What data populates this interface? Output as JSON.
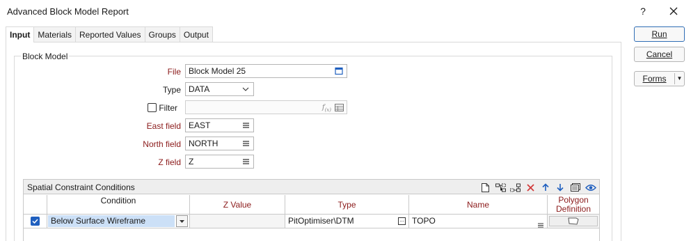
{
  "window": {
    "title": "Advanced Block Model Report",
    "help_label": "?"
  },
  "tabs": [
    {
      "label": "Input",
      "active": true
    },
    {
      "label": "Materials",
      "active": false
    },
    {
      "label": "Reported Values",
      "active": false
    },
    {
      "label": "Groups",
      "active": false
    },
    {
      "label": "Output",
      "active": false
    }
  ],
  "buttons": {
    "run_label": "Run",
    "cancel_label": "Cancel",
    "forms_label": "Forms",
    "forms_arrow": "▼"
  },
  "block_model": {
    "legend": "Block Model",
    "file_label": "File",
    "file_value": "Block Model 25",
    "type_label": "Type",
    "type_value": "DATA",
    "filter_label": "Filter",
    "filter_checked": false,
    "filter_value": "",
    "east_label": "East field",
    "east_value": "EAST",
    "north_label": "North field",
    "north_value": "NORTH",
    "z_label": "Z field",
    "z_value": "Z"
  },
  "spatial": {
    "title": "Spatial Constraint Conditions",
    "columns": {
      "condition": "Condition",
      "zvalue": "Z Value",
      "type": "Type",
      "name": "Name",
      "polygon_line1": "Polygon",
      "polygon_line2": "Definition"
    },
    "rows": [
      {
        "checked": true,
        "condition": "Below Surface Wireframe",
        "zvalue": "",
        "type": "PitOptimiser\\DTM",
        "name": "TOPO"
      }
    ],
    "toolbar_icons": [
      "new-icon",
      "insert-icon",
      "append-icon",
      "delete-icon",
      "move-up-icon",
      "move-down-icon",
      "list-icon",
      "view-icon"
    ]
  },
  "colors": {
    "required_label": "#8b1a1a",
    "accent": "#1f5fbf",
    "selected_cell": "#cce0f7",
    "delete_red": "#d23c3c"
  }
}
